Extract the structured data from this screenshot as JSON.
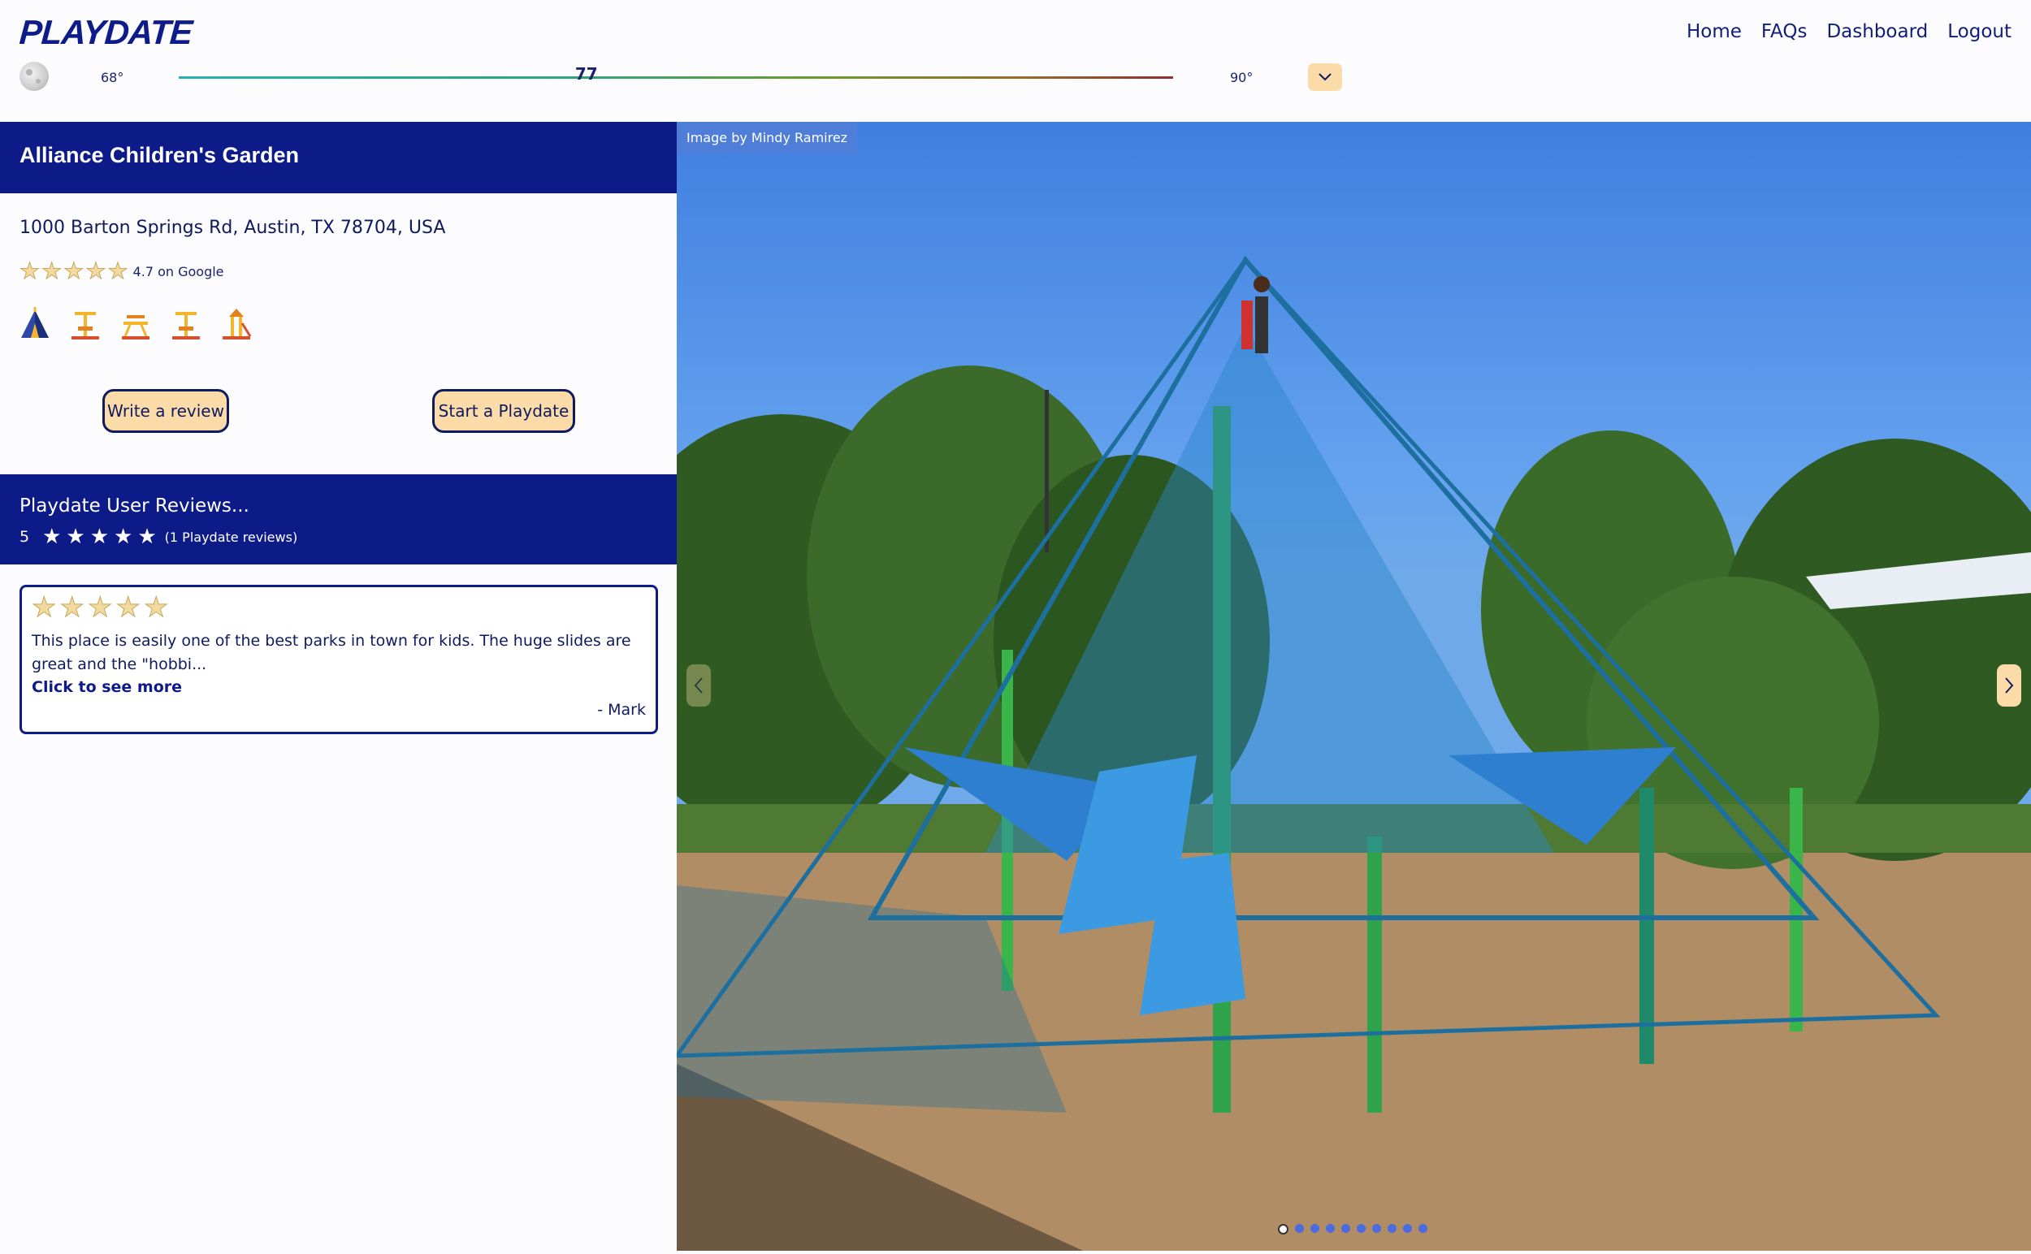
{
  "brand": {
    "logo": "PLAYDATE"
  },
  "nav": {
    "home": "Home",
    "faqs": "FAQs",
    "dashboard": "Dashboard",
    "logout": "Logout"
  },
  "weather": {
    "icon": "moon-icon",
    "low": "68°",
    "current": "77",
    "high": "90°",
    "current_fraction": 0.41
  },
  "park": {
    "name": "Alliance Children's Garden",
    "address": "1000 Barton Springs Rd, Austin, TX 78704, USA",
    "google_rating": 4.7,
    "google_rating_text": "4.7 on Google",
    "amenity_icons": [
      "camping-tent-icon",
      "swing-icon",
      "picnic-table-icon",
      "swing-icon",
      "playground-tower-icon"
    ]
  },
  "actions": {
    "write_review": "Write a review",
    "start_playdate": "Start a Playdate"
  },
  "reviews": {
    "header": "Playdate User Reviews...",
    "average": "5",
    "average_stars": 5,
    "count_text": "(1 Playdate reviews)",
    "items": [
      {
        "stars": 5,
        "text": "This place is easily one of the best parks in town for kids. The huge slides are great and the \"hobbi...",
        "more": "Click to see more",
        "author": "- Mark"
      }
    ]
  },
  "photo": {
    "credit": "Image by Mindy Ramirez",
    "slide_count": 10,
    "active_slide": 1
  },
  "colors": {
    "navy": "#0d1b88",
    "accent_peach": "#fbdba7",
    "background": "#fcfbfe"
  }
}
